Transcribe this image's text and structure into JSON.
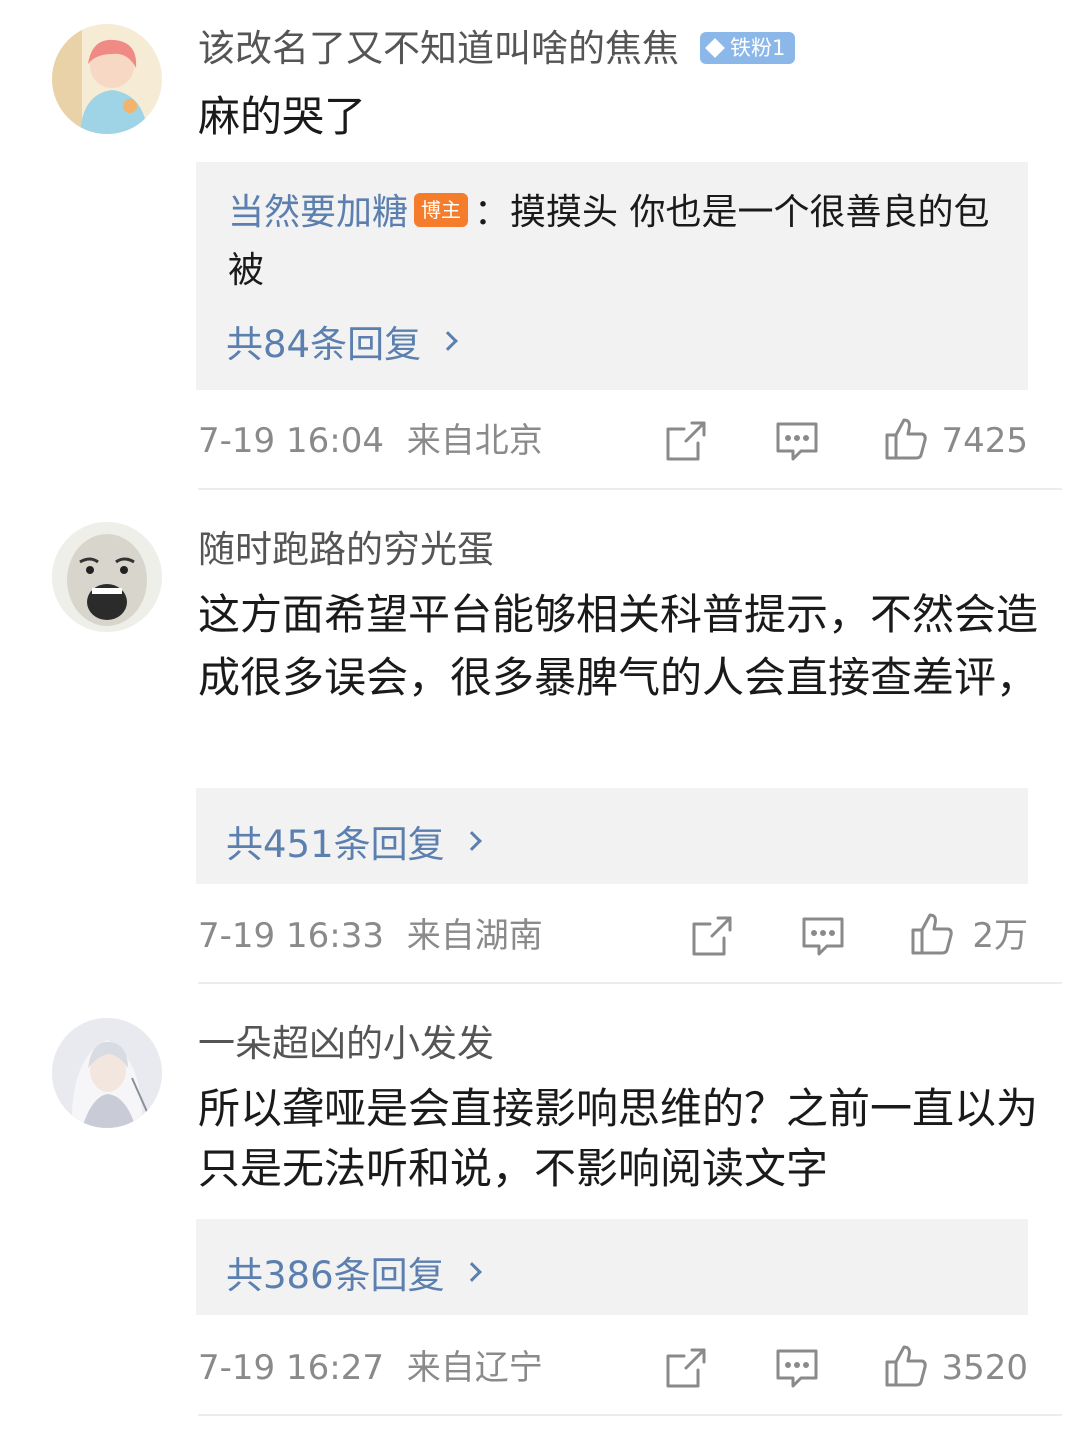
{
  "comments": [
    {
      "username": "该改名了又不知道叫啥的焦焦",
      "fan_badge": "铁粉1",
      "content": "麻的哭了",
      "reply": {
        "author": "当然要加糖",
        "host_badge": "博主",
        "text": "：摸摸头 你也是一个很善良的包被"
      },
      "reply_count": "共84条回复",
      "time": "7-19 16:04",
      "location": "来自北京",
      "likes": "7425"
    },
    {
      "username": "随时跑路的穷光蛋",
      "content": "这方面希望平台能够相关科普提示，不然会造成很多误会，很多暴脾气的人会直接查差评，",
      "reply_count": "共451条回复",
      "time": "7-19 16:33",
      "location": "来自湖南",
      "likes": "2万"
    },
    {
      "username": "一朵超凶的小发发",
      "content": "所以聋哑是会直接影响思维的？之前一直以为只是无法听和说，不影响阅读文字",
      "reply_count": "共386条回复",
      "time": "7-19 16:27",
      "location": "来自辽宁",
      "likes": "3520"
    }
  ],
  "icons": {
    "share": "share-icon",
    "comment": "comment-icon",
    "like": "thumbs-up-icon"
  },
  "colors": {
    "link_blue": "#5b7fae",
    "host_badge": "#f47c2a",
    "fan_badge": "#8bb8e8",
    "reply_bg": "#f2f2f2"
  }
}
